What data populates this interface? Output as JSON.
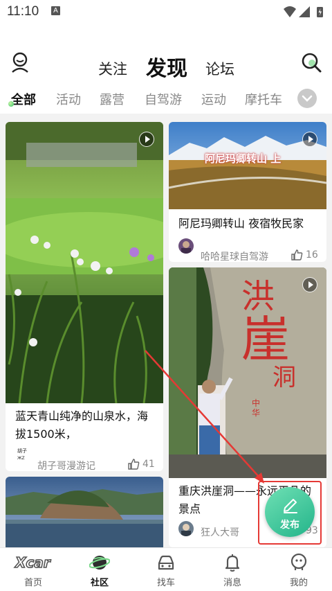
{
  "status_bar": {
    "time": "11:10",
    "notification_icon": "A",
    "icons": [
      "wifi-icon",
      "signal-icon",
      "battery-icon"
    ]
  },
  "header": {
    "tabs": [
      {
        "label": "关注",
        "active": false
      },
      {
        "label": "发现",
        "active": true
      },
      {
        "label": "论坛",
        "active": false
      }
    ],
    "left_icon": "user-icon",
    "right_icon": "search-icon"
  },
  "categories": {
    "items": [
      "全部",
      "活动",
      "露营",
      "自驾游",
      "运动",
      "摩托车"
    ],
    "active": "全部",
    "more_icon": "chevron-down-icon"
  },
  "feed": {
    "cards": [
      {
        "title": "蓝天青山纯净的山泉水，海拔1500米，",
        "author": "胡子哥漫游记",
        "likes": "41",
        "video": true
      },
      {
        "title": "阿尼玛卿转山 夜宿牧民家",
        "image_caption": "阿尼玛卿转山 上",
        "author": "哈哈星球自驾游",
        "likes": "16",
        "video": true
      },
      {
        "title": "重庆洪崖洞——永远平凡的景点",
        "author": "狂人大哥",
        "likes": "93",
        "video": true
      },
      {
        "title": "",
        "author": "",
        "likes": "",
        "video": false
      }
    ]
  },
  "fab": {
    "label": "发布",
    "icon": "edit-icon"
  },
  "bottom_nav": {
    "items": [
      {
        "label": "首页",
        "icon": "xcar-logo-icon",
        "active": false
      },
      {
        "label": "社区",
        "icon": "planet-icon",
        "active": true
      },
      {
        "label": "找车",
        "icon": "car-icon",
        "active": false
      },
      {
        "label": "消息",
        "icon": "bell-icon",
        "active": false
      },
      {
        "label": "我的",
        "icon": "profile-icon",
        "active": false
      }
    ]
  },
  "colors": {
    "accent": "#2dbb8f",
    "highlight": "#e53935",
    "arrow": "#e53935",
    "background": "#f2f2f2"
  }
}
